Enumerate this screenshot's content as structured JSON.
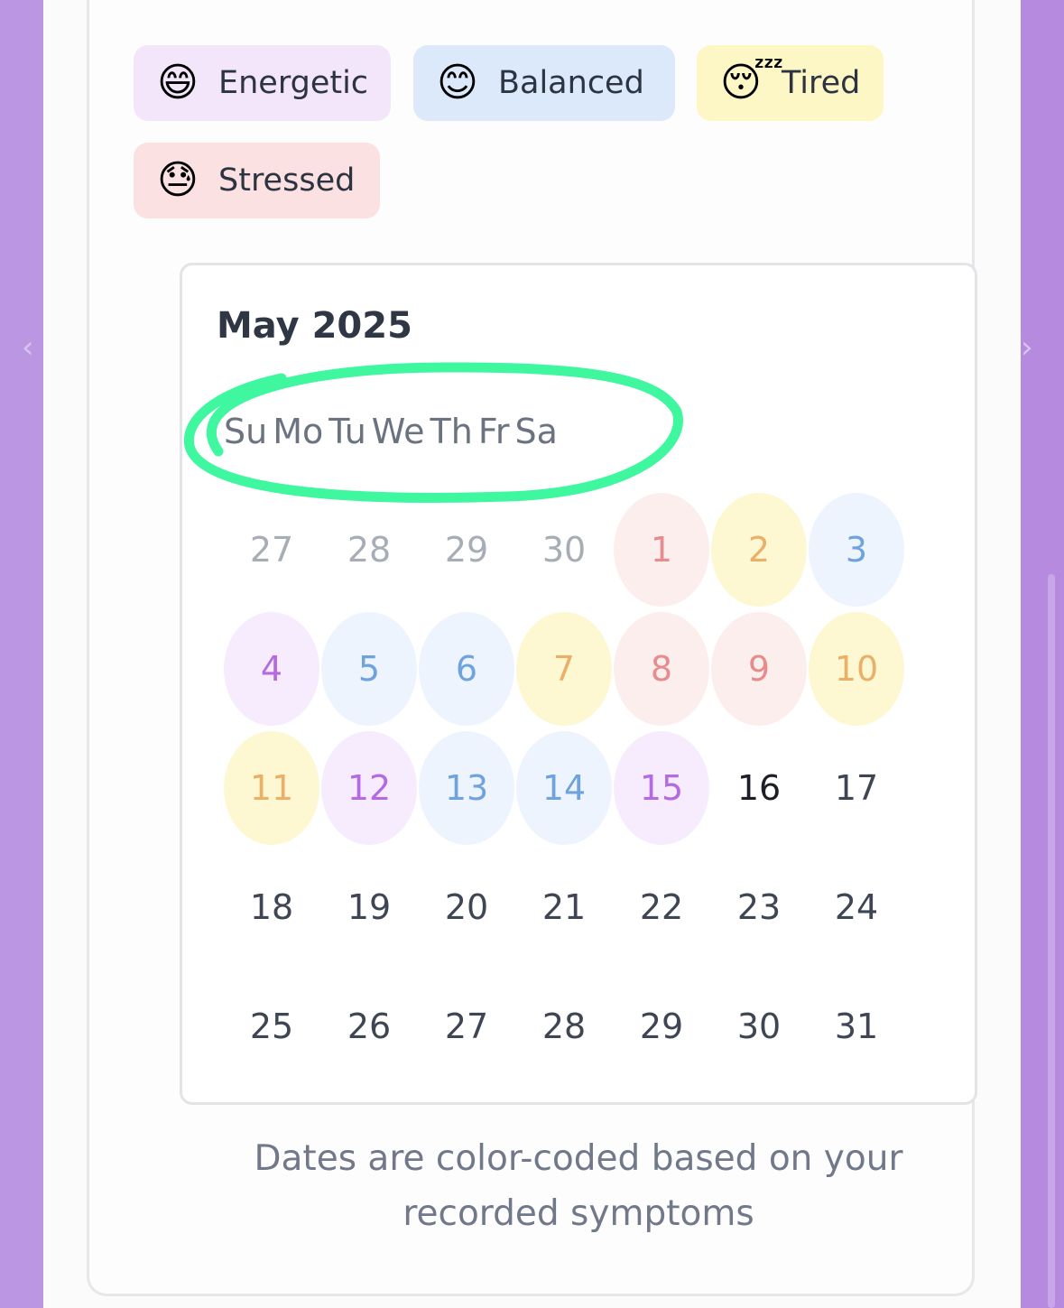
{
  "moods": [
    {
      "emoji": "😄",
      "label": "Energetic",
      "bg": "#f3e6fb"
    },
    {
      "emoji": "😊",
      "label": "Balanced",
      "bg": "#dbe9fb"
    },
    {
      "emoji": "😴",
      "label": "Tired",
      "bg": "#fdf6c5"
    },
    {
      "emoji": "😓",
      "label": "Stressed",
      "bg": "#fbe1e1"
    }
  ],
  "calendar": {
    "month_label": "May 2025",
    "weekdays": [
      "Su",
      "Mo",
      "Tu",
      "We",
      "Th",
      "Fr",
      "Sa"
    ],
    "annotation_color": "#3ff79f",
    "mood_styles": {
      "energetic": {
        "bg": "#f6ecfd",
        "color": "#b46ae0"
      },
      "balanced": {
        "bg": "#eef4fd",
        "color": "#6fa3de"
      },
      "tired": {
        "bg": "#fdf8d2",
        "color": "#eab06a"
      },
      "stressed": {
        "bg": "#fdeeee",
        "color": "#e68c8c"
      }
    },
    "weeks": [
      [
        {
          "d": "27",
          "m": "out"
        },
        {
          "d": "28",
          "m": "out"
        },
        {
          "d": "29",
          "m": "out"
        },
        {
          "d": "30",
          "m": "out"
        },
        {
          "d": "1",
          "m": "stressed"
        },
        {
          "d": "2",
          "m": "tired"
        },
        {
          "d": "3",
          "m": "balanced"
        }
      ],
      [
        {
          "d": "4",
          "m": "energetic"
        },
        {
          "d": "5",
          "m": "balanced"
        },
        {
          "d": "6",
          "m": "balanced"
        },
        {
          "d": "7",
          "m": "tired"
        },
        {
          "d": "8",
          "m": "stressed"
        },
        {
          "d": "9",
          "m": "stressed"
        },
        {
          "d": "10",
          "m": "tired"
        }
      ],
      [
        {
          "d": "11",
          "m": "tired"
        },
        {
          "d": "12",
          "m": "energetic"
        },
        {
          "d": "13",
          "m": "balanced"
        },
        {
          "d": "14",
          "m": "balanced"
        },
        {
          "d": "15",
          "m": "energetic"
        },
        {
          "d": "16",
          "m": "today"
        },
        {
          "d": "17",
          "m": "none"
        }
      ],
      [
        {
          "d": "18",
          "m": "none"
        },
        {
          "d": "19",
          "m": "none"
        },
        {
          "d": "20",
          "m": "none"
        },
        {
          "d": "21",
          "m": "none"
        },
        {
          "d": "22",
          "m": "none"
        },
        {
          "d": "23",
          "m": "none"
        },
        {
          "d": "24",
          "m": "none"
        }
      ],
      [
        {
          "d": "25",
          "m": "none"
        },
        {
          "d": "26",
          "m": "none"
        },
        {
          "d": "27",
          "m": "none"
        },
        {
          "d": "28",
          "m": "none"
        },
        {
          "d": "29",
          "m": "none"
        },
        {
          "d": "30",
          "m": "none"
        },
        {
          "d": "31",
          "m": "none"
        }
      ]
    ]
  },
  "footer_text": "Dates are color-coded based on your recorded symptoms"
}
